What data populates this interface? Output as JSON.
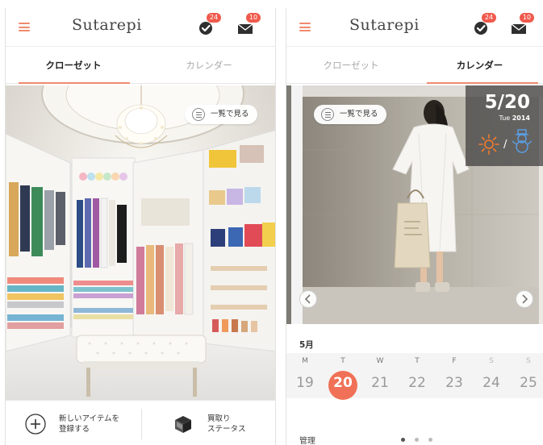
{
  "colors": {
    "accent": "#f08a6d",
    "badge": "#ef5a4c",
    "selected_day": "#f07157",
    "sun_icon": "#f27c2d",
    "snowman_icon": "#5aa0e8"
  },
  "left_screen": {
    "app_title": "Sutarepi",
    "menu_icon": "hamburger-icon",
    "closet_badge": "24",
    "mail_badge": "10",
    "tabs": [
      {
        "label": "クローゼット",
        "active": true
      },
      {
        "label": "カレンダー",
        "active": false
      }
    ],
    "view_list_label": "一覧で見る",
    "actions": [
      {
        "icon": "plus-circle-icon",
        "line1": "新しいアイテムを",
        "line2": "登録する"
      },
      {
        "icon": "box-icon",
        "line1": "買取り",
        "line2": "ステータス"
      }
    ]
  },
  "right_screen": {
    "app_title": "Sutarepi",
    "closet_badge": "24",
    "mail_badge": "10",
    "tabs": [
      {
        "label": "クローゼット",
        "active": false
      },
      {
        "label": "カレンダー",
        "active": true
      }
    ],
    "view_list_label": "一覧で見る",
    "date": {
      "day_month": "5/20",
      "weekday": "Tue",
      "year": "2014",
      "separator": "/"
    },
    "weather_icons": [
      "sun-icon",
      "snowman-icon"
    ],
    "month_label": "5月",
    "week": [
      {
        "dow": "M",
        "day": "19",
        "selected": false
      },
      {
        "dow": "T",
        "day": "20",
        "selected": true
      },
      {
        "dow": "W",
        "day": "21",
        "selected": false
      },
      {
        "dow": "T",
        "day": "22",
        "selected": false
      },
      {
        "dow": "F",
        "day": "23",
        "selected": false
      },
      {
        "dow": "S",
        "day": "24",
        "selected": false
      },
      {
        "dow": "S",
        "day": "25",
        "selected": false
      }
    ],
    "manage_label": "管理",
    "pager_dots": 3,
    "pager_active_index": 0
  }
}
